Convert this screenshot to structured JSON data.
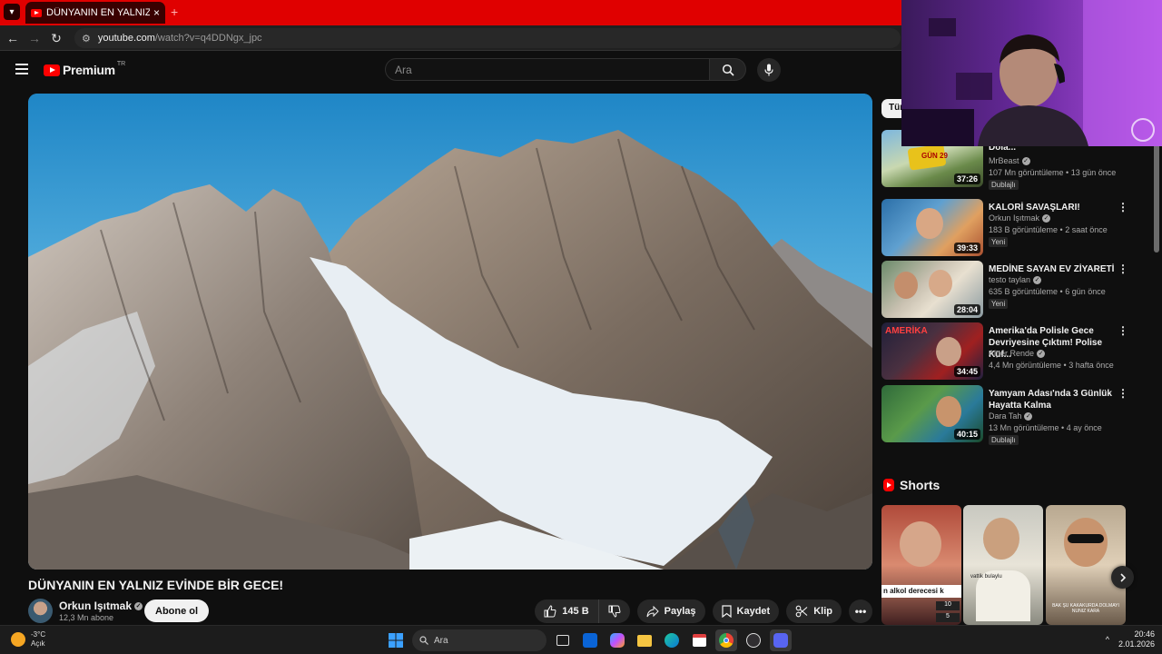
{
  "browser": {
    "tab_title": "DÜNYANIN EN YALNIZ EVİNDE",
    "tab_close": "×",
    "new_tab": "+",
    "url_host": "youtube.com",
    "url_path": "/watch?v=q4DDNgx_jpc"
  },
  "header": {
    "logo_text": "Premium",
    "country_code": "TR",
    "search_placeholder": "Ara"
  },
  "video": {
    "title": "DÜNYANIN EN YALNIZ EVİNDE BİR GECE!",
    "channel": "Orkun Işıtmak",
    "subscribers": "12,3 Mn abone",
    "subscribe_label": "Abone ol",
    "likes": "145 B",
    "share_label": "Paylaş",
    "save_label": "Kaydet",
    "clip_label": "Klip",
    "more_label": "•••"
  },
  "sidebar": {
    "chip_label": "Tüm",
    "recommendations": [
      {
        "title": "Gün Hayatta Kal, 250.000 Dola...",
        "channel": "MrBeast",
        "meta": "107 Mn görüntüleme • 13 gün önce",
        "badge": "Dublajlı",
        "duration": "37:26"
      },
      {
        "title": "KALORİ SAVAŞLARI!",
        "channel": "Orkun Işıtmak",
        "meta": "183 B görüntüleme • 2 saat önce",
        "badge": "Yeni",
        "duration": "39:33"
      },
      {
        "title": "MEDİNE SAYAN EV ZİYARETİ",
        "channel": "testo taylan",
        "meta": "635 B görüntüleme • 6 gün önce",
        "badge": "Yeni",
        "duration": "28:04"
      },
      {
        "title": "Amerika'da Polisle Gece Devriyesine Çıktım! Polise Küf...",
        "channel": "Alper Rende",
        "meta": "4,4 Mn görüntüleme • 3 hafta önce",
        "badge": "",
        "duration": "34:45"
      },
      {
        "title": "Yamyam Adası'nda 3 Günlük Hayatta Kalma",
        "channel": "Dara Tah",
        "meta": "13 Mn görüntüleme • 4 ay önce",
        "badge": "Dublajlı",
        "duration": "40:15"
      }
    ],
    "shorts_heading": "Shorts",
    "short_captions": [
      "n alkol derecesi k",
      "vattik bulaylu",
      "BAK ŞU KAKAKURDA DOLMAYI NUNIZ KARA"
    ],
    "short_numbers": [
      "10",
      "5"
    ]
  },
  "taskbar": {
    "temperature": "-3°C",
    "weather_desc": "Açık",
    "search_label": "Ara",
    "time": "20:46",
    "date": "2.01.2026"
  },
  "colors": {
    "brand_red": "#ff0000",
    "tab_bar": "#e00000",
    "background": "#0f0f0f",
    "chip_bg": "#272727"
  }
}
